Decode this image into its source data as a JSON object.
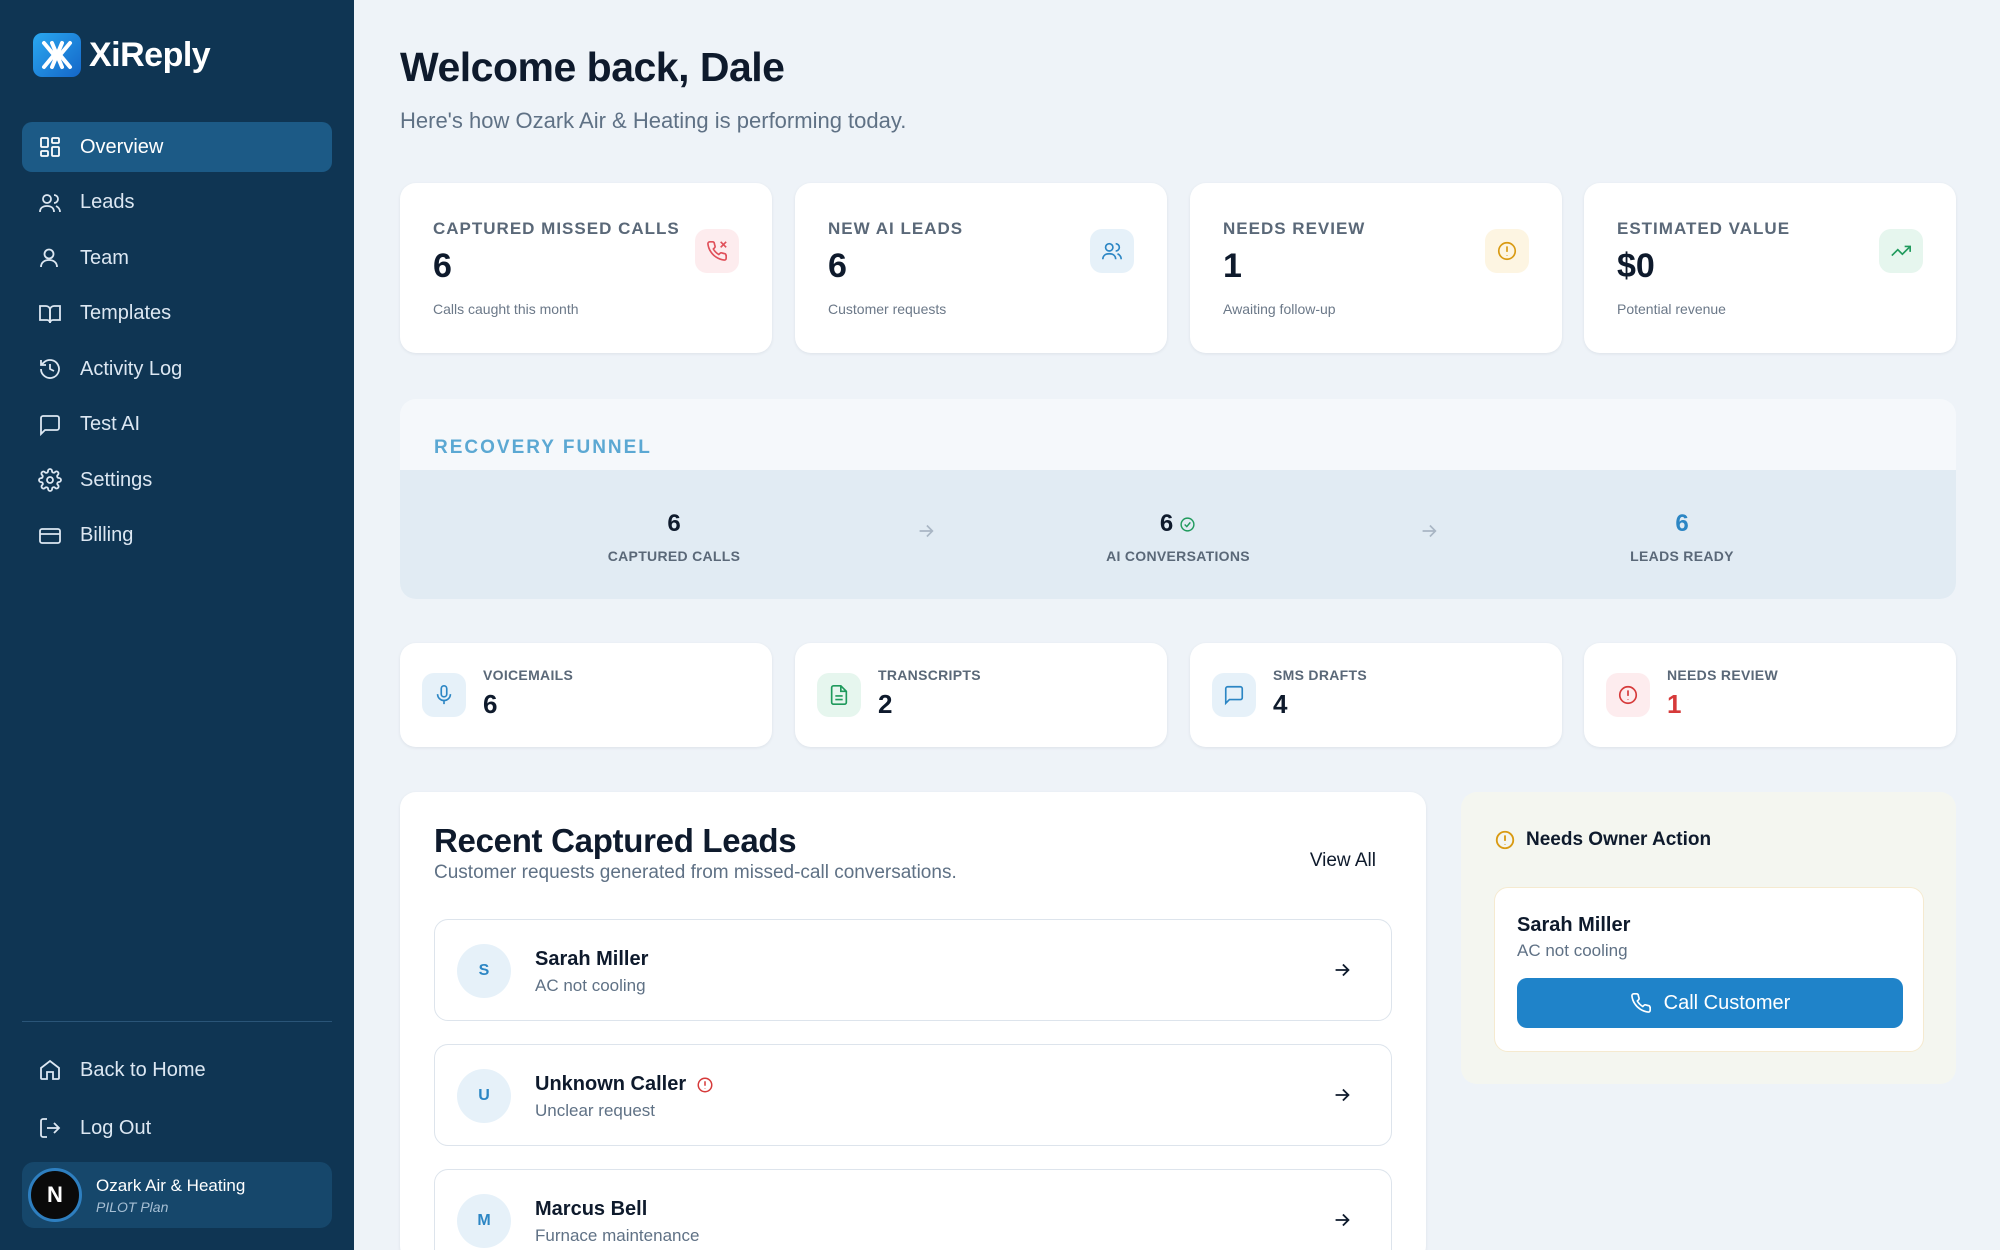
{
  "brand": {
    "name": "XiReply"
  },
  "sidebar": {
    "items": [
      {
        "label": "Overview",
        "icon": "dashboard-icon",
        "active": true
      },
      {
        "label": "Leads",
        "icon": "users-icon"
      },
      {
        "label": "Team",
        "icon": "user-icon"
      },
      {
        "label": "Templates",
        "icon": "book-icon"
      },
      {
        "label": "Activity Log",
        "icon": "history-icon"
      },
      {
        "label": "Test AI",
        "icon": "chat-icon"
      },
      {
        "label": "Settings",
        "icon": "gear-icon"
      },
      {
        "label": "Billing",
        "icon": "credit-card-icon"
      }
    ],
    "bottom": [
      {
        "label": "Back to Home",
        "icon": "home-icon"
      },
      {
        "label": "Log Out",
        "icon": "logout-icon"
      }
    ],
    "account": {
      "initial": "N",
      "name": "Ozark Air & Heating",
      "plan": "PILOT Plan"
    }
  },
  "header": {
    "title": "Welcome back, Dale",
    "subtitle": "Here's how Ozark Air & Heating is performing today."
  },
  "stats": [
    {
      "label": "CAPTURED MISSED CALLS",
      "value": "6",
      "caption": "Calls caught this month",
      "icon": "phone-missed-icon",
      "color": "#e0505a",
      "bg": "#fdecee"
    },
    {
      "label": "NEW AI LEADS",
      "value": "6",
      "caption": "Customer requests",
      "icon": "users-icon",
      "color": "#2c86c4",
      "bg": "#e6f1f9"
    },
    {
      "label": "NEEDS REVIEW",
      "value": "1",
      "caption": "Awaiting follow-up",
      "icon": "alert-circle-icon",
      "color": "#d99a12",
      "bg": "#fdf5e2"
    },
    {
      "label": "ESTIMATED VALUE",
      "value": "$0",
      "caption": "Potential revenue",
      "icon": "trending-up-icon",
      "color": "#1f9a5c",
      "bg": "#e6f6ee"
    }
  ],
  "funnel": {
    "title": "RECOVERY FUNNEL",
    "steps": [
      {
        "value": "6",
        "label": "CAPTURED CALLS"
      },
      {
        "value": "6",
        "label": "AI CONVERSATIONS"
      },
      {
        "value": "6",
        "label": "LEADS READY"
      }
    ]
  },
  "mini_stats": [
    {
      "label": "VOICEMAILS",
      "value": "6",
      "icon": "mic-icon",
      "color": "#2c86c4",
      "bg": "#e6f1f9"
    },
    {
      "label": "TRANSCRIPTS",
      "value": "2",
      "icon": "document-icon",
      "color": "#1f9a5c",
      "bg": "#e6f6ee"
    },
    {
      "label": "SMS DRAFTS",
      "value": "4",
      "icon": "message-icon",
      "color": "#2c86c4",
      "bg": "#e6f1f9"
    },
    {
      "label": "NEEDS REVIEW",
      "value": "1",
      "icon": "alert-circle-icon",
      "color": "#d63a3a",
      "bg": "#fdecee"
    }
  ],
  "leads": {
    "title": "Recent Captured Leads",
    "subtitle": "Customer requests generated from missed-call conversations.",
    "view_all": "View All",
    "rows": [
      {
        "initial": "S",
        "name": "Sarah Miller",
        "desc": "AC not cooling",
        "flag": false
      },
      {
        "initial": "U",
        "name": "Unknown Caller",
        "desc": "Unclear request",
        "flag": true
      },
      {
        "initial": "M",
        "name": "Marcus Bell",
        "desc": "Furnace maintenance",
        "flag": false
      }
    ]
  },
  "owner_action": {
    "title": "Needs Owner Action",
    "name": "Sarah Miller",
    "desc": "AC not cooling",
    "button": "Call Customer"
  }
}
